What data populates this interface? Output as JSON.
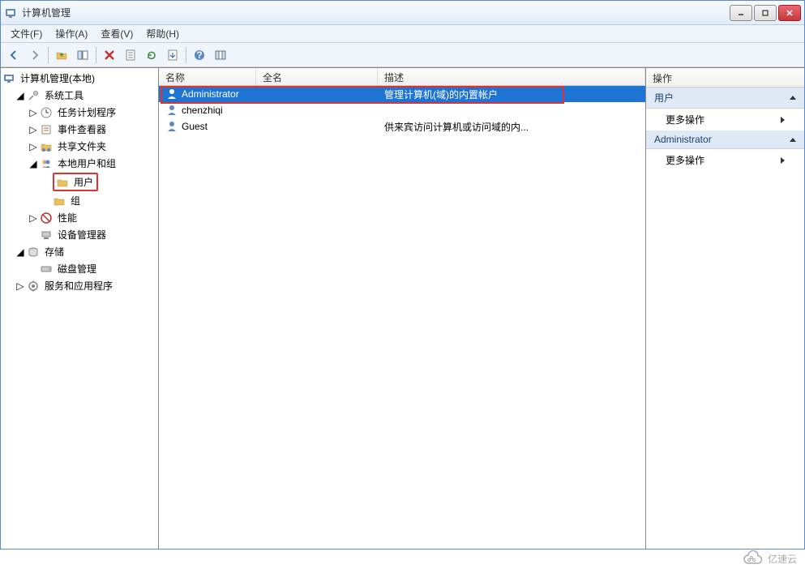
{
  "window": {
    "title": "计算机管理"
  },
  "menubar": {
    "file": "文件(F)",
    "action": "操作(A)",
    "view": "查看(V)",
    "help": "帮助(H)"
  },
  "tree": {
    "root": "计算机管理(本地)",
    "system_tools": "系统工具",
    "task_scheduler": "任务计划程序",
    "event_viewer": "事件查看器",
    "shared_folders": "共享文件夹",
    "local_users_groups": "本地用户和组",
    "users": "用户",
    "groups": "组",
    "performance": "性能",
    "device_manager": "设备管理器",
    "storage": "存储",
    "disk_management": "磁盘管理",
    "services_apps": "服务和应用程序"
  },
  "list": {
    "columns": {
      "name": "名称",
      "fullname": "全名",
      "description": "描述"
    },
    "rows": [
      {
        "name": "Administrator",
        "fullname": "",
        "description": "管理计算机(域)的内置帐户",
        "selected": true,
        "highlight": true
      },
      {
        "name": "chenzhiqi",
        "fullname": "",
        "description": "",
        "selected": false
      },
      {
        "name": "Guest",
        "fullname": "",
        "description": "供来宾访问计算机或访问域的内...",
        "selected": false
      }
    ]
  },
  "actions": {
    "title": "操作",
    "section1": "用户",
    "more_actions": "更多操作",
    "section2": "Administrator"
  },
  "watermark": "亿速云"
}
